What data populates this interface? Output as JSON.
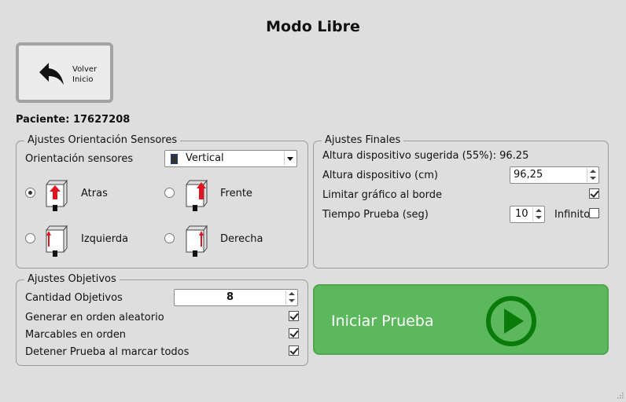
{
  "window": {
    "title": "Modo Libre"
  },
  "back_button": {
    "line1": "Volver",
    "line2": "Inicio",
    "icon": "undo-arrow-icon"
  },
  "patient": {
    "label": "Paciente: 17627208"
  },
  "orientation_group": {
    "title": "Ajustes Orientación Sensores",
    "combo_label": "Orientación sensores",
    "combo_value": "Vertical",
    "options": [
      {
        "label": "Atras",
        "checked": true
      },
      {
        "label": "Frente",
        "checked": false
      },
      {
        "label": "Izquierda",
        "checked": false
      },
      {
        "label": "Derecha",
        "checked": false
      }
    ]
  },
  "final_group": {
    "title": "Ajustes Finales",
    "suggested_height": "Altura dispositivo sugerida (55%): 96.25",
    "height_label": "Altura dispositivo (cm)",
    "height_value": "96,25",
    "limit_label": "Limitar gráfico al borde",
    "limit_checked": true,
    "time_label": "Tiempo Prueba (seg)",
    "time_value": "10",
    "infinite_label": "Infinito",
    "infinite_checked": false
  },
  "objectives_group": {
    "title": "Ajustes Objetivos",
    "count_label": "Cantidad Objetivos",
    "count_value": "8",
    "random_label": "Generar en orden aleatorio",
    "random_checked": true,
    "ordered_label": "Marcables en orden",
    "ordered_checked": true,
    "stop_label": "Detener Prueba al marcar todos",
    "stop_checked": true
  },
  "start_button": {
    "label": "Iniciar Prueba",
    "icon": "play-circle-icon"
  },
  "colors": {
    "start_green": "#5cb85c",
    "play_dark_green": "#0a7a0a",
    "arrow_red": "#e0141e"
  }
}
